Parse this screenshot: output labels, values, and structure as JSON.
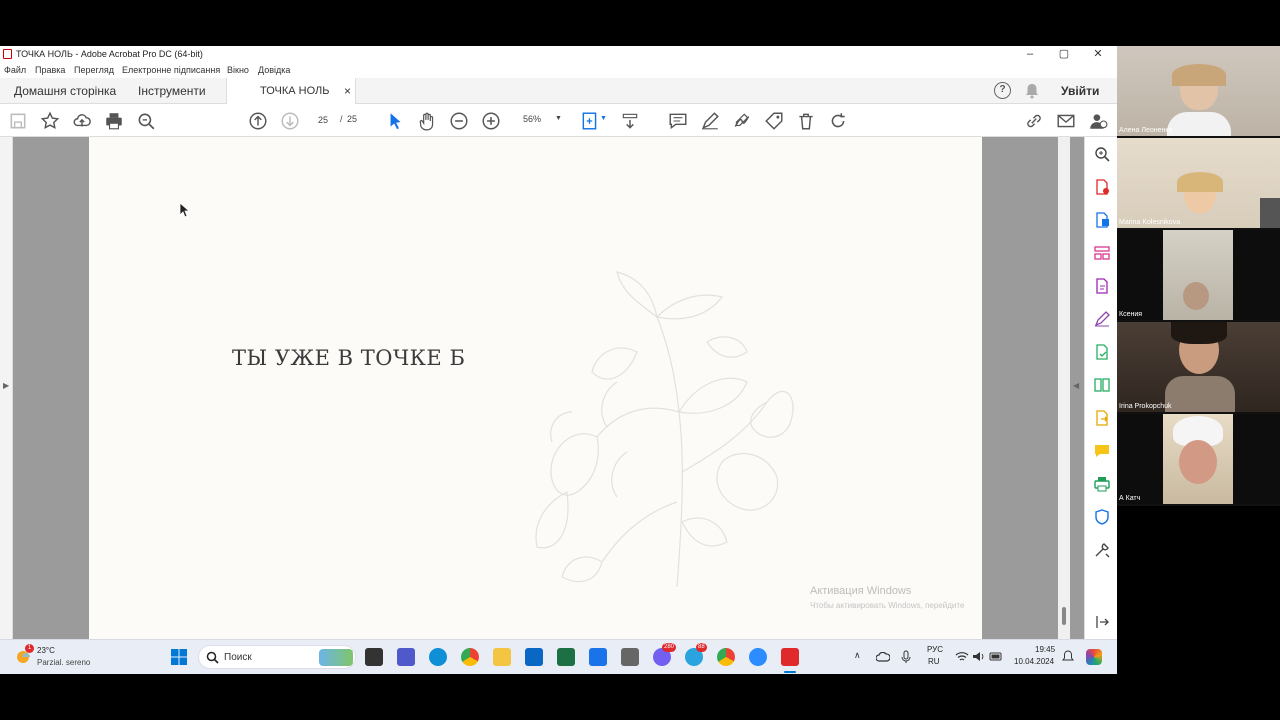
{
  "window": {
    "title": "ТОЧКА НОЛЬ - Adobe Acrobat Pro DC (64-bit)",
    "controls": [
      "–",
      "▢",
      "✕"
    ]
  },
  "menu": [
    "Файл",
    "Правка",
    "Перегляд",
    "Електронне підписання",
    "Вікно",
    "Довідка"
  ],
  "tabs": {
    "home": "Домашня сторінка",
    "tools": "Інструменти",
    "doc": "ТОЧКА НОЛЬ",
    "close": "×",
    "signin": "Увійти"
  },
  "toolbar": {
    "page_current": "25",
    "page_sep": "/",
    "page_total": "25",
    "zoom": "56%"
  },
  "slide": {
    "text": "ТЫ УЖЕ В ТОЧКЕ Б"
  },
  "watermark": {
    "line1": "Активация Windows",
    "line2": "Чтобы активировать Windows, перейдите"
  },
  "taskbar": {
    "weather_temp": "23°C",
    "weather_desc": "Parzial. sereno",
    "weather_badge": "1",
    "search": "Поиск",
    "lang_top": "РУС",
    "lang_bottom": "RU",
    "time": "19:45",
    "date": "10.04.2024",
    "badge_viber": "280",
    "badge_telegram": "88"
  },
  "participants": [
    {
      "name": "Алена Леоненко"
    },
    {
      "name": "Marina Kolesnikova"
    },
    {
      "name": "Ксения"
    },
    {
      "name": "Irina Prokopchuk"
    },
    {
      "name": "А Катч"
    }
  ],
  "colors": {
    "accent": "#1473e6",
    "acrobat_red": "#e0292b",
    "page_bg": "#fcfbf8"
  }
}
